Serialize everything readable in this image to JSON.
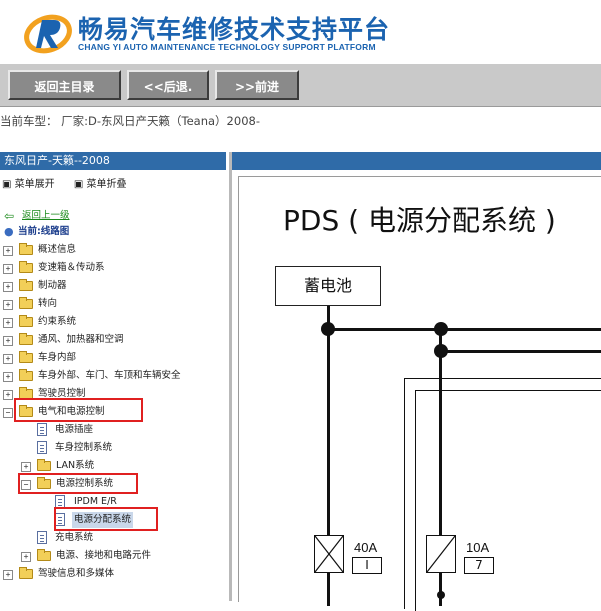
{
  "header": {
    "title": "畅易汽车维修技术支持平台",
    "subtitle": "CHANG YI AUTO MAINTENANCE TECHNOLOGY SUPPORT PLATFORM"
  },
  "nav": {
    "home": "返回主目录",
    "back": "<<后退.",
    "forward": ">>前进"
  },
  "model_bar": {
    "text": "当前车型：  厂家:D-东风日产天籁（Teana）2008-"
  },
  "sidebar": {
    "heading": "东风日产-天籁--2008",
    "expand": "菜单展开",
    "collapse": "菜单折叠",
    "up_link": "返回上一级",
    "current": "当前:线路图",
    "tree": [
      {
        "label": "概述信息"
      },
      {
        "label": "变速箱＆传动系"
      },
      {
        "label": "制动器"
      },
      {
        "label": "转向"
      },
      {
        "label": "约束系统"
      },
      {
        "label": "通风、加热器和空调"
      },
      {
        "label": "车身内部"
      },
      {
        "label": "车身外部、车门、车顶和车辆安全"
      },
      {
        "label": "驾驶员控制"
      },
      {
        "label": "电气和电源控制"
      },
      {
        "label": "电源插座"
      },
      {
        "label": "车身控制系统"
      },
      {
        "label": "LAN系统"
      },
      {
        "label": "电源控制系统"
      },
      {
        "label": "IPDM E/R"
      },
      {
        "label": "电源分配系统"
      },
      {
        "label": "充电系统"
      },
      {
        "label": "电源、接地和电路元件"
      },
      {
        "label": "驾驶信息和多媒体"
      }
    ]
  },
  "diagram": {
    "title": "PDS ( 电源分配系统 )",
    "battery": "蓄电池",
    "fuses": [
      {
        "amp": "40A",
        "num": "I"
      },
      {
        "amp": "10A",
        "num": "7"
      }
    ]
  },
  "colors": {
    "brand": "#1b63b0",
    "highlight": "#e02020",
    "panel_header": "#2f6ba8"
  }
}
